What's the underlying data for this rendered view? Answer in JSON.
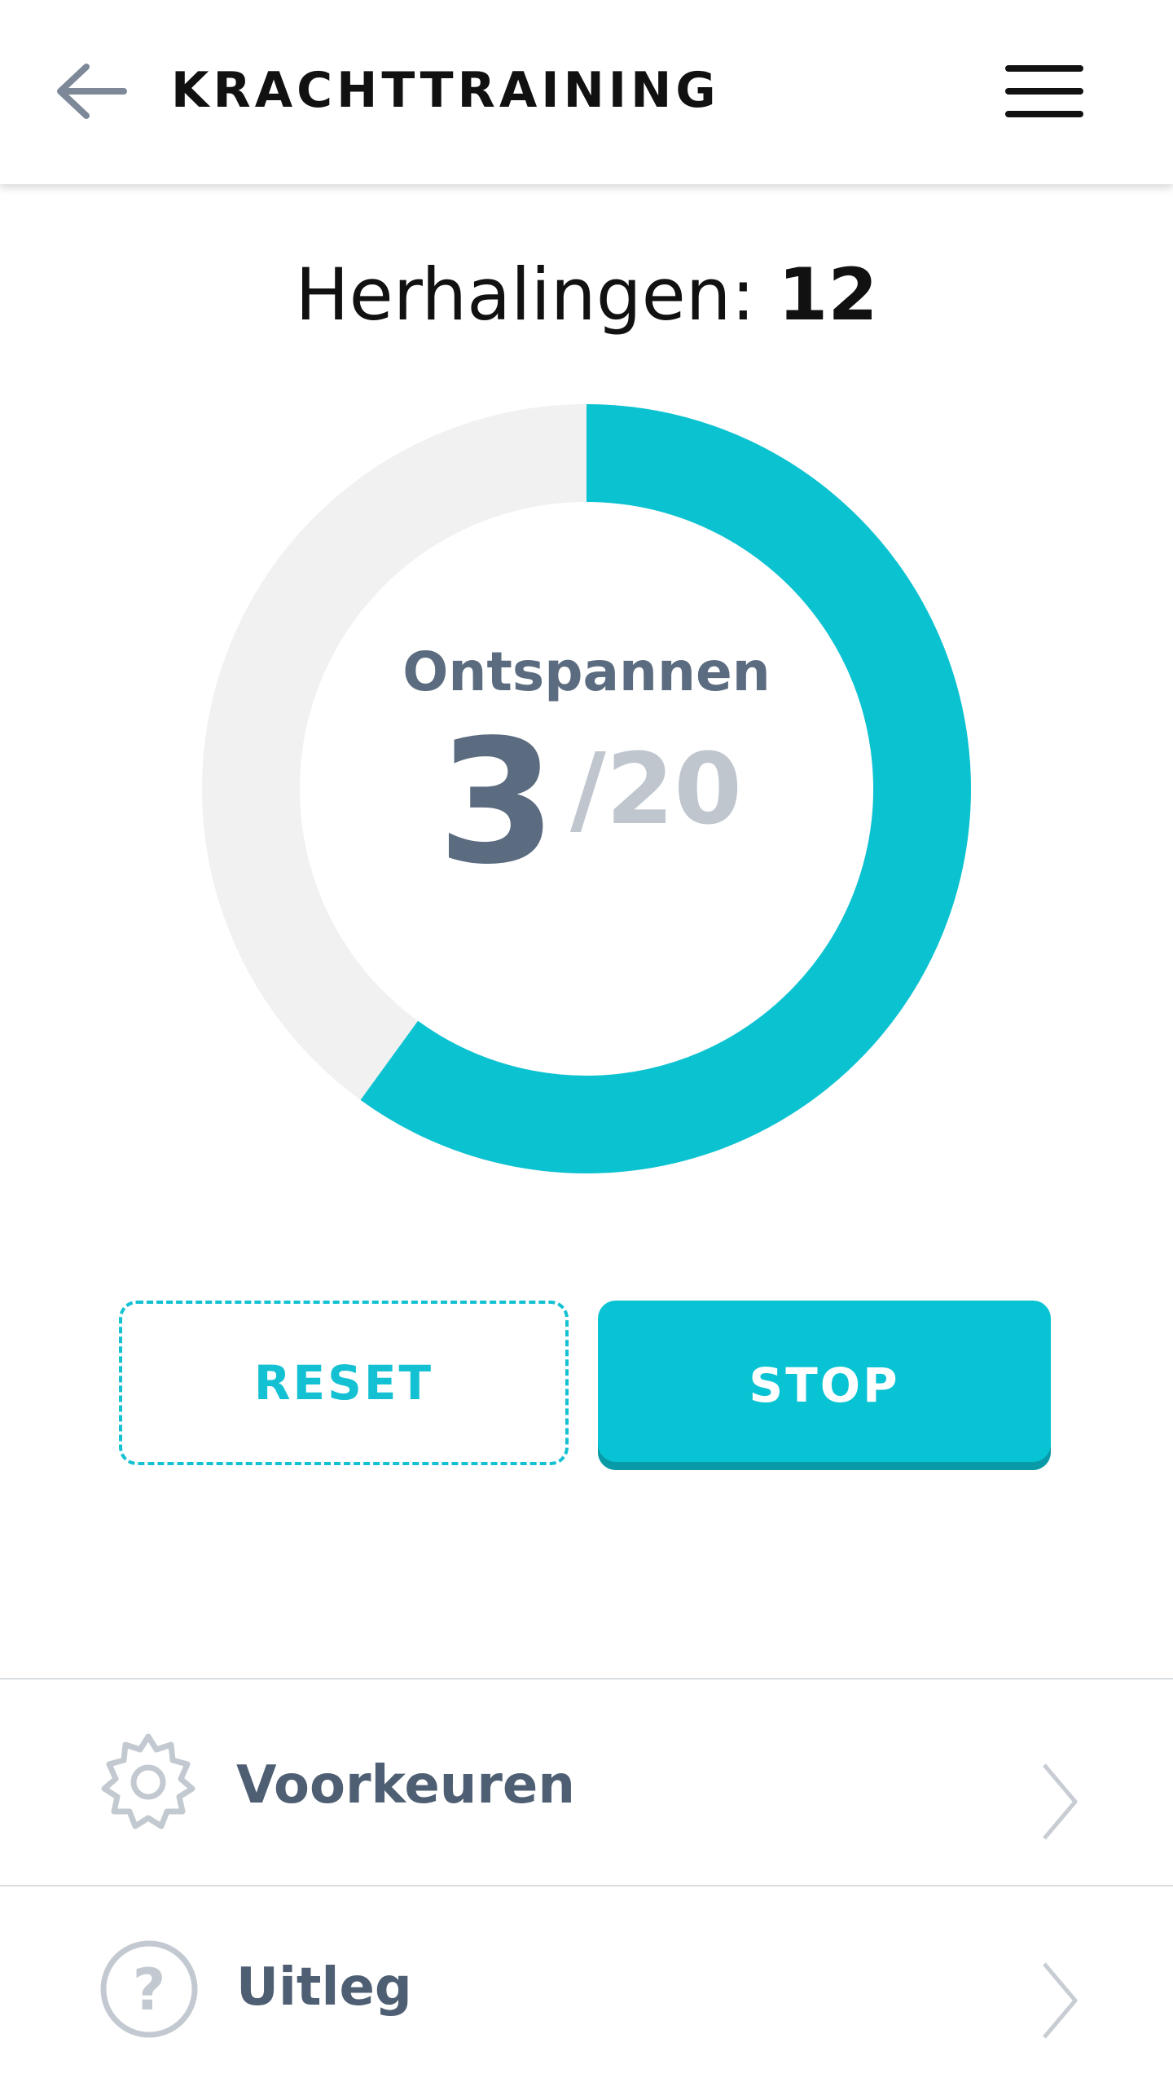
{
  "header": {
    "title": "KRACHTTRAINING",
    "back_icon": "arrow-left-icon",
    "menu_icon": "hamburger-menu-icon"
  },
  "repetitions": {
    "label": "Herhalingen:",
    "value": "12"
  },
  "timer": {
    "phase": "Ontspannen",
    "current": "3",
    "total": "/20",
    "progress_fraction": 0.6,
    "colors": {
      "progress": "#0bc2d1",
      "track": "#f1f1f1"
    }
  },
  "actions": {
    "reset_label": "RESET",
    "stop_label": "STOP",
    "accent": "#08c3d3"
  },
  "menu": [
    {
      "label": "Voorkeuren",
      "icon": "gear-icon"
    },
    {
      "label": "Uitleg",
      "icon": "question-circle-icon"
    }
  ]
}
